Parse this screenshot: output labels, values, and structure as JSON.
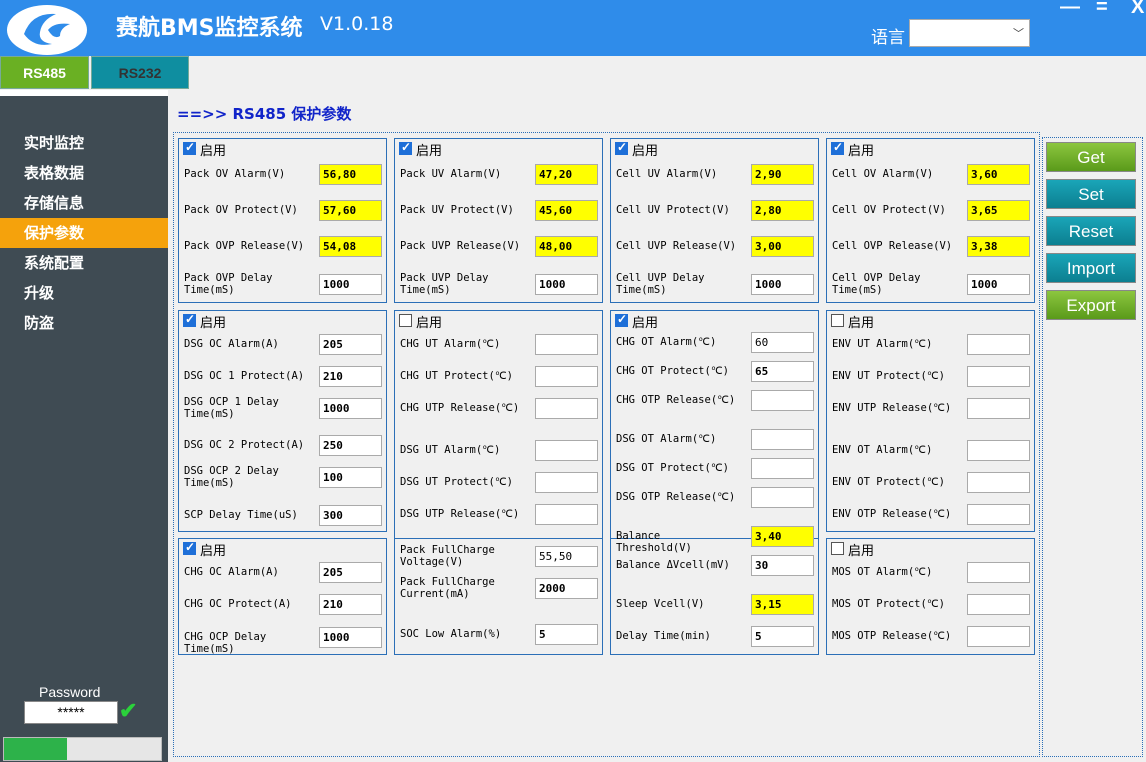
{
  "app": {
    "title": "赛航BMS监控系统",
    "version": "V1.0.18",
    "lang_label": "语言",
    "lang_value": "",
    "min": "—",
    "max": "=",
    "close": "X"
  },
  "tabs": {
    "rs485": "RS485",
    "rs232": "RS232"
  },
  "sidebar": {
    "items": [
      "实时监控",
      "表格数据",
      "存储信息",
      "保护参数",
      "系统配置",
      "升级",
      "防盗"
    ],
    "active_index": 3
  },
  "password": {
    "label": "Password",
    "value": "*****"
  },
  "progress": {
    "value": 0.4
  },
  "heading": "==>> RS485 保护参数",
  "enable_label": "启用",
  "buttons": {
    "get": "Get",
    "set": "Set",
    "reset": "Reset",
    "import": "Import",
    "export": "Export"
  },
  "panels": {
    "p1": {
      "enabled": true,
      "rows": [
        {
          "label": "Pack OV Alarm(V)",
          "value": "56,80"
        },
        {
          "label": "Pack OV Protect(V)",
          "value": "57,60"
        },
        {
          "label": "Pack OVP Release(V)",
          "value": "54,08"
        },
        {
          "label": "Pack OVP Delay Time(mS)",
          "value": "1000"
        }
      ]
    },
    "p2": {
      "enabled": true,
      "rows": [
        {
          "label": "Pack UV Alarm(V)",
          "value": "47,20"
        },
        {
          "label": "Pack UV Protect(V)",
          "value": "45,60"
        },
        {
          "label": "Pack UVP Release(V)",
          "value": "48,00"
        },
        {
          "label": "Pack UVP Delay Time(mS)",
          "value": "1000"
        }
      ]
    },
    "p3": {
      "enabled": true,
      "rows": [
        {
          "label": "Cell UV Alarm(V)",
          "value": "2,90"
        },
        {
          "label": "Cell UV Protect(V)",
          "value": "2,80"
        },
        {
          "label": "Cell UVP Release(V)",
          "value": "3,00"
        },
        {
          "label": "Cell UVP Delay Time(mS)",
          "value": "1000"
        }
      ]
    },
    "p4": {
      "enabled": true,
      "rows": [
        {
          "label": "Cell OV Alarm(V)",
          "value": "3,60"
        },
        {
          "label": "Cell OV Protect(V)",
          "value": "3,65"
        },
        {
          "label": "Cell OVP Release(V)",
          "value": "3,38"
        },
        {
          "label": "Cell OVP Delay Time(mS)",
          "value": "1000"
        }
      ]
    },
    "p5": {
      "enabled": true,
      "rows": [
        {
          "label": "DSG OC Alarm(A)",
          "value": "205"
        },
        {
          "label": "DSG OC 1 Protect(A)",
          "value": "210"
        },
        {
          "label": "DSG OCP 1 Delay Time(mS)",
          "value": "1000"
        },
        {
          "label": "DSG OC 2 Protect(A)",
          "value": "250"
        },
        {
          "label": "DSG OCP 2 Delay Time(mS)",
          "value": "100"
        },
        {
          "label": "SCP Delay Time(uS)",
          "value": "300"
        }
      ]
    },
    "p6": {
      "enabled": false,
      "rows": [
        {
          "label": "CHG UT Alarm(℃)",
          "value": ""
        },
        {
          "label": "CHG UT Protect(℃)",
          "value": ""
        },
        {
          "label": "CHG UTP Release(℃)",
          "value": ""
        },
        {
          "label": "DSG UT Alarm(℃)",
          "value": ""
        },
        {
          "label": "DSG UT Protect(℃)",
          "value": ""
        },
        {
          "label": "DSG UTP Release(℃)",
          "value": ""
        }
      ]
    },
    "p7": {
      "enabled": true,
      "rows": [
        {
          "label": "CHG OT Alarm(℃)",
          "value": "60"
        },
        {
          "label": "CHG OT Protect(℃)",
          "value": "65"
        },
        {
          "label": "CHG OTP Release(℃)",
          "value": ""
        },
        {
          "label": "DSG OT Alarm(℃)",
          "value": ""
        },
        {
          "label": "DSG OT Protect(℃)",
          "value": ""
        },
        {
          "label": "DSG OTP Release(℃)",
          "value": ""
        }
      ]
    },
    "p8": {
      "enabled": false,
      "rows": [
        {
          "label": "ENV UT Alarm(℃)",
          "value": ""
        },
        {
          "label": "ENV UT Protect(℃)",
          "value": ""
        },
        {
          "label": "ENV UTP Release(℃)",
          "value": ""
        },
        {
          "label": "ENV OT Alarm(℃)",
          "value": ""
        },
        {
          "label": "ENV OT Protect(℃)",
          "value": ""
        },
        {
          "label": "ENV OTP Release(℃)",
          "value": ""
        }
      ]
    },
    "p9": {
      "enabled": true,
      "rows": [
        {
          "label": "CHG OC Alarm(A)",
          "value": "205"
        },
        {
          "label": "CHG OC Protect(A)",
          "value": "210"
        },
        {
          "label": "CHG OCP Delay Time(mS)",
          "value": "1000"
        }
      ]
    },
    "p10": {
      "rows": [
        {
          "label": "Pack FullCharge Voltage(V)",
          "value": "55,50"
        },
        {
          "label": "Pack FullCharge Current(mA)",
          "value": "2000"
        },
        {
          "label": "SOC Low Alarm(%)",
          "value": "5"
        }
      ]
    },
    "p11": {
      "rows": [
        {
          "label": "Balance Threshold(V)",
          "value": "3,40"
        },
        {
          "label": "Balance ΔVcell(mV)",
          "value": "30"
        },
        {
          "label": "Sleep Vcell(V)",
          "value": "3,15"
        },
        {
          "label": "Delay Time(min)",
          "value": "5"
        }
      ]
    },
    "p12": {
      "enabled": false,
      "rows": [
        {
          "label": "MOS OT Alarm(℃)",
          "value": ""
        },
        {
          "label": "MOS OT Protect(℃)",
          "value": ""
        },
        {
          "label": "MOS OTP Release(℃)",
          "value": ""
        }
      ]
    }
  },
  "colors": {
    "titlebar": "#2f8cea",
    "sidebar": "#3f4b53",
    "active": "#f5a20c",
    "highlight": "#ffff00",
    "heading": "#1124c9"
  }
}
